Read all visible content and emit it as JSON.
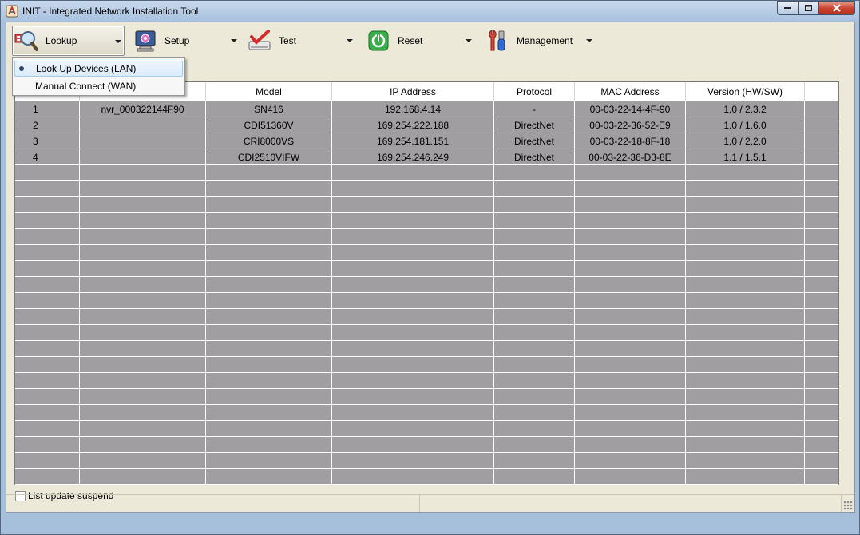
{
  "window": {
    "title": "INIT - Integrated Network Installation Tool",
    "icon": "init-app-icon"
  },
  "toolbar": {
    "buttons": [
      {
        "label": "Lookup",
        "icon": "magnifier-icon"
      },
      {
        "label": "Setup",
        "icon": "monitor-gear-icon"
      },
      {
        "label": "Test",
        "icon": "checkmark-scanner-icon"
      },
      {
        "label": "Reset",
        "icon": "power-icon"
      },
      {
        "label": "Management",
        "icon": "tools-icon"
      }
    ]
  },
  "lookup_menu": {
    "items": [
      {
        "label": "Look Up Devices (LAN)",
        "selected": true
      },
      {
        "label": "Manual Connect (WAN)",
        "selected": false
      }
    ]
  },
  "table": {
    "columns": [
      "",
      "",
      "Model",
      "IP Address",
      "Protocol",
      "MAC Address",
      "Version (HW/SW)",
      ""
    ],
    "rows": [
      {
        "no": "1",
        "name": "nvr_000322144F90",
        "model": "SN416",
        "ip": "192.168.4.14",
        "protocol": "-",
        "mac": "00-03-22-14-4F-90",
        "version": "1.0 / 2.3.2"
      },
      {
        "no": "2",
        "name": "",
        "model": "CDI51360V",
        "ip": "169.254.222.188",
        "protocol": "DirectNet",
        "mac": "00-03-22-36-52-E9",
        "version": "1.0 / 1.6.0"
      },
      {
        "no": "3",
        "name": "",
        "model": "CRI8000VS",
        "ip": "169.254.181.151",
        "protocol": "DirectNet",
        "mac": "00-03-22-18-8F-18",
        "version": "1.0 / 2.2.0"
      },
      {
        "no": "4",
        "name": "",
        "model": "CDI2510VIFW",
        "ip": "169.254.246.249",
        "protocol": "DirectNet",
        "mac": "00-03-22-36-D3-8E",
        "version": "1.1 / 1.5.1"
      }
    ]
  },
  "options": {
    "list_update_suspend_label": "List update suspend",
    "list_update_suspend_checked": false
  },
  "colors": {
    "grid_background": "#a09ea1",
    "client_background": "#ece9d8",
    "header_background": "#ffffff",
    "menu_highlight": "#dcebfb"
  }
}
